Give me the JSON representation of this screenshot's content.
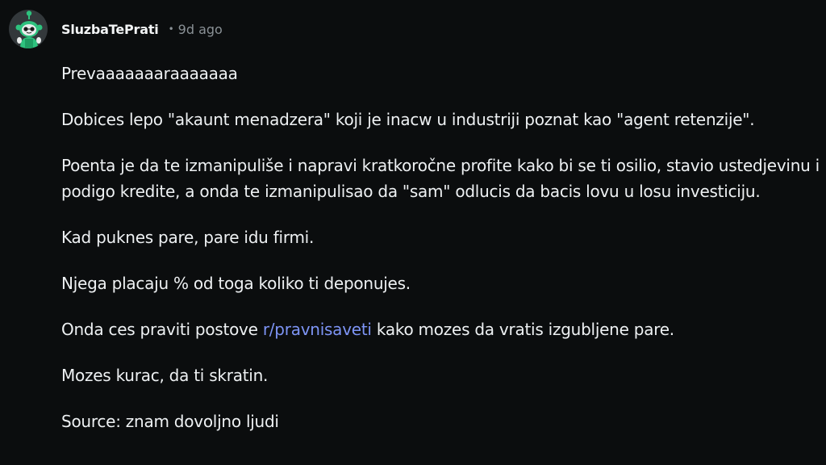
{
  "comment": {
    "author": "SluzbaTePrati",
    "separator": "•",
    "age": "9d ago",
    "paragraphs": {
      "p1": "Prevaaaaaaaraaaaaaa",
      "p2": "Dobices lepo \"akaunt menadzera\" koji je inacw u industriji poznat kao \"agent retenzije\".",
      "p3": "Poenta je da te izmanipuliše i napravi kratkoročne profite kako bi se ti osilio, stavio ustedjevinu i podigo kredite, a onda te izmanipulisao da \"sam\" odlucis da bacis lovu u losu investiciju.",
      "p4": "Kad puknes pare, pare idu firmi.",
      "p5": "Njega placaju % od toga koliko ti deponujes.",
      "p6_before": "Onda ces praviti postove ",
      "p6_link": "r/pravnisaveti",
      "p6_after": " kako mozes da vratis izgubljene pare.",
      "p7": "Mozes kurac, da ti skratin.",
      "p8": "Source: znam dovoljno ljudi"
    }
  },
  "colors": {
    "background": "#0b0d0e",
    "text": "#eef1f3",
    "meta": "#8a9196",
    "link": "#7d94f5",
    "avatar_green": "#2ec27e"
  },
  "icons": {
    "avatar": "snoo-avatar-icon"
  }
}
